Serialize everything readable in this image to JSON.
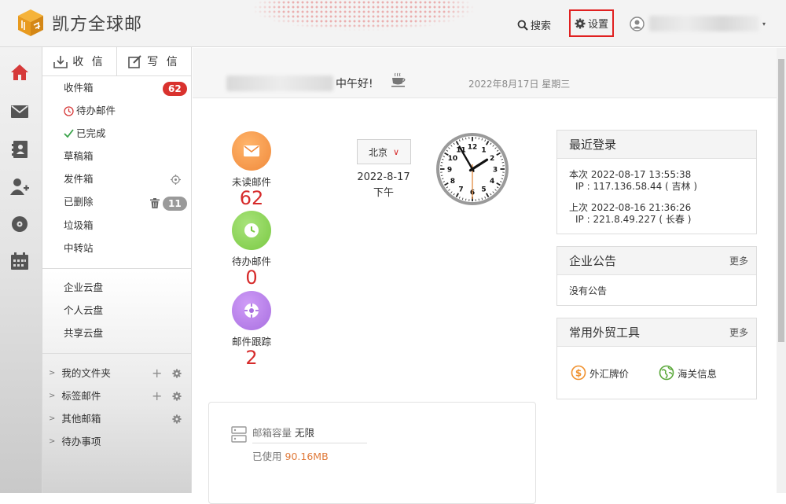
{
  "header": {
    "logo_text": "凯方全球邮",
    "search_label": "搜索",
    "settings_label": "设置"
  },
  "iconbar": [
    {
      "name": "home-icon",
      "color": "#d63a3a"
    },
    {
      "name": "mail-icon",
      "color": "#555555"
    },
    {
      "name": "contacts-icon",
      "color": "#555555"
    },
    {
      "name": "add-user-icon",
      "color": "#555555"
    },
    {
      "name": "disk-icon",
      "color": "#555555"
    },
    {
      "name": "calendar-icon",
      "color": "#555555"
    }
  ],
  "sidebar": {
    "receive_label": "收 信",
    "write_label": "写 信",
    "folders": {
      "inbox": {
        "label": "收件箱",
        "badge": "62"
      },
      "todo": {
        "label": "待办邮件"
      },
      "done": {
        "label": "已完成"
      },
      "drafts": {
        "label": "草稿箱"
      },
      "sent": {
        "label": "发件箱"
      },
      "deleted": {
        "label": "已删除",
        "badge": "11"
      },
      "junk": {
        "label": "垃圾箱"
      },
      "relay": {
        "label": "中转站"
      }
    },
    "disks": {
      "enterprise": "企业云盘",
      "personal": "个人云盘",
      "shared": "共享云盘"
    },
    "trees": {
      "my_folders": "我的文件夹",
      "tag_mail": "标签邮件",
      "other_mailbox": "其他邮箱",
      "todo_items": "待办事项"
    }
  },
  "greeting": {
    "text": "中午好!",
    "date": "2022年8月17日 星期三"
  },
  "stats": {
    "unread": {
      "label": "未读邮件",
      "value": "62",
      "color": "#f08a3c"
    },
    "todo": {
      "label": "待办邮件",
      "value": "0",
      "color": "#7ac943"
    },
    "tracking": {
      "label": "邮件跟踪",
      "value": "2",
      "color": "#a86fe0"
    }
  },
  "clock": {
    "city": "北京",
    "date": "2022-8-17",
    "period": "下午",
    "time_readout": "13:55",
    "numbers": [
      "12",
      "1",
      "2",
      "3",
      "4",
      "5",
      "6",
      "7",
      "8",
      "9",
      "10",
      "11"
    ]
  },
  "storage": {
    "title": "邮箱容量",
    "capacity": "无限",
    "used_label": "已使用",
    "used_value": "90.16MB"
  },
  "recent_login": {
    "title": "最近登录",
    "current": {
      "line1": "本次 2022-08-17 13:55:38",
      "line2": "IP : 117.136.58.44 ( 吉林 )"
    },
    "previous": {
      "line1": "上次 2022-08-16 21:36:26",
      "line2": "IP : 221.8.49.227 ( 长春 )"
    }
  },
  "announcement": {
    "title": "企业公告",
    "more": "更多",
    "empty_text": "没有公告"
  },
  "tools": {
    "title": "常用外贸工具",
    "more": "更多",
    "fx_label": "外汇牌价",
    "customs_label": "海关信息"
  }
}
